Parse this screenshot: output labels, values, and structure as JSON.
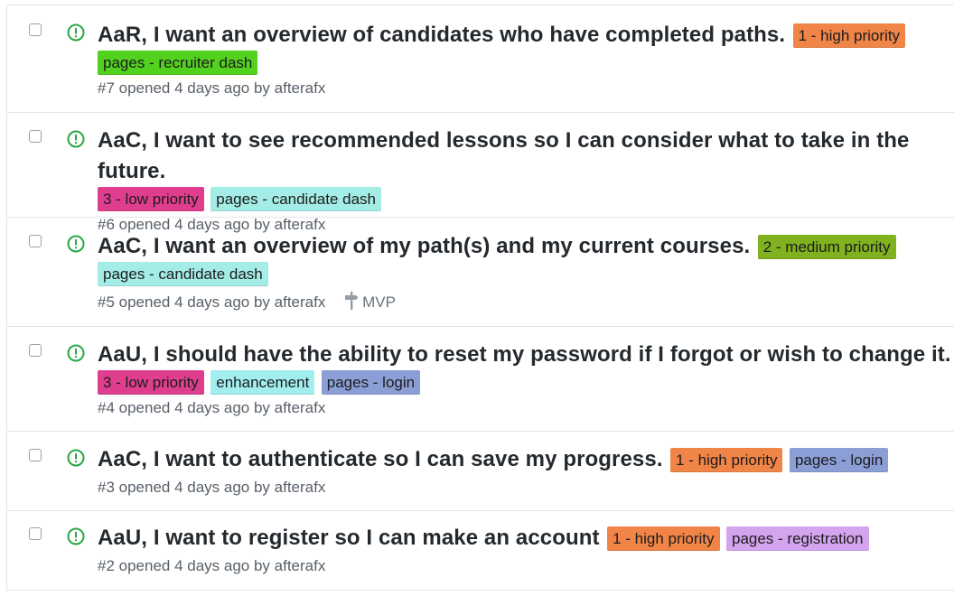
{
  "colors": {
    "open_icon": "#28a745",
    "high": "#f18547",
    "low": "#de3e8d",
    "medium": "#80b11f",
    "recruiter": "#52d11e",
    "candidate": "#a4ece6",
    "enhancement": "#a2eeef",
    "login": "#8b9fd6",
    "registration": "#d4a4ef"
  },
  "issues": [
    {
      "title": "AaR, I want an overview of candidates who have completed paths.",
      "labels": [
        "1 - high priority",
        "pages - recruiter dash"
      ],
      "meta": "#7 opened 4 days ago by afterafx"
    },
    {
      "title": "AaC, I want to see recommended lessons so I can consider what to take in the future.",
      "labels": [
        "3 - low priority",
        "pages - candidate dash"
      ],
      "meta": "#6 opened 4 days ago by afterafx"
    },
    {
      "title": "AaC, I want an overview of my path(s) and my current courses.",
      "labels": [
        "2 - medium priority",
        "pages - candidate dash"
      ],
      "meta": "#5 opened 4 days ago by afterafx",
      "milestone": "MVP"
    },
    {
      "title": "AaU, I should have the ability to reset my password if I forgot or wish to change it.",
      "labels": [
        "3 - low priority",
        "enhancement",
        "pages - login"
      ],
      "meta": "#4 opened 4 days ago by afterafx"
    },
    {
      "title": "AaC, I want to authenticate so I can save my progress.",
      "labels": [
        "1 - high priority",
        "pages - login"
      ],
      "meta": "#3 opened 4 days ago by afterafx"
    },
    {
      "title": "AaU, I want to register so I can make an account",
      "labels": [
        "1 - high priority",
        "pages - registration"
      ],
      "meta": "#2 opened 4 days ago by afterafx"
    }
  ]
}
